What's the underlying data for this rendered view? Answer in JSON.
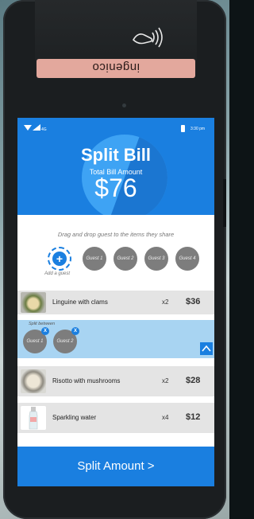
{
  "device": {
    "brand": "ingenico"
  },
  "status_bar": {
    "network": "4G",
    "time": "3:30 pm"
  },
  "header": {
    "title": "Split Bill",
    "subtitle": "Total Bill Amount",
    "amount": "$76"
  },
  "instructions": "Drag and drop guest to the items they share",
  "guests": {
    "add_label": "Add a guest",
    "list": [
      "Guest 1",
      "Guest 2",
      "Guest 3",
      "Guest 4"
    ]
  },
  "items": [
    {
      "name": "Linguine with clams",
      "qty": "x2",
      "price": "$36"
    },
    {
      "name": "Risotto with mushrooms",
      "qty": "x2",
      "price": "$28"
    },
    {
      "name": "Sparkling water",
      "qty": "x4",
      "price": "$12"
    }
  ],
  "split": {
    "label": "Split between",
    "guests": [
      "Guest 1",
      "Guest 2"
    ],
    "remove_symbol": "X"
  },
  "action": {
    "label": "Split Amount >"
  },
  "colors": {
    "primary": "#1a7fe0",
    "split_panel": "#a8d4f2",
    "guest_circle": "#7d7d7d",
    "item_row": "#e4e4e4"
  }
}
